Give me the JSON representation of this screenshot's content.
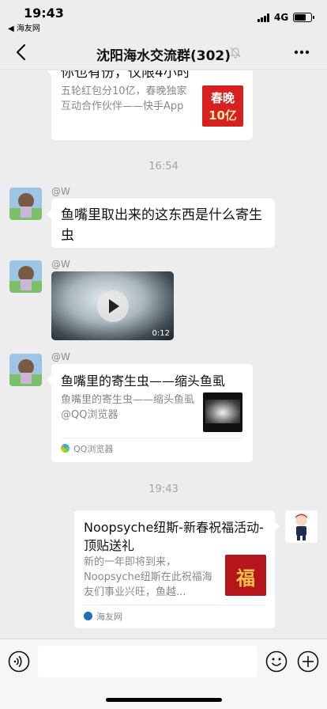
{
  "status_bar": {
    "time": "19:43",
    "back_app": "◀ 海友网",
    "network": "4G",
    "battery_level": 0.75
  },
  "header": {
    "title": "沈阳海水交流群(302)",
    "muted": true
  },
  "messages": [
    {
      "type": "card",
      "side": "left",
      "title": "你也有份，仅限4小时",
      "desc": "五轮红包分10亿，春晚独家互动合作伙伴——快手App",
      "thumb_text_1": "春晚",
      "thumb_text_2": "10亿"
    },
    {
      "type": "time",
      "text": "16:54"
    },
    {
      "type": "text",
      "side": "left",
      "sender": "@W",
      "text": "鱼嘴里取出来的这东西是什么寄生虫"
    },
    {
      "type": "video",
      "side": "left",
      "sender": "@W",
      "duration": "0:12"
    },
    {
      "type": "card",
      "side": "left",
      "sender": "@W",
      "title": "鱼嘴里的寄生虫——缩头鱼虱",
      "desc": "鱼嘴里的寄生虫——缩头鱼虱 @QQ浏览器",
      "source": "QQ浏览器"
    },
    {
      "type": "time",
      "text": "19:43"
    },
    {
      "type": "card",
      "side": "right",
      "title": "Noopsyche纽斯-新春祝福活动-顶贴送礼",
      "desc": "新的一年即将到来，Noopsyche纽斯在此祝福海友们事业兴旺，鱼越...",
      "thumb_text": "福",
      "source": "海友网"
    }
  ],
  "input_bar": {
    "placeholder": ""
  },
  "colors": {
    "background": "#ededed",
    "bubble": "#ffffff",
    "accent_red": "#d7201f",
    "muted_text": "#888888"
  }
}
